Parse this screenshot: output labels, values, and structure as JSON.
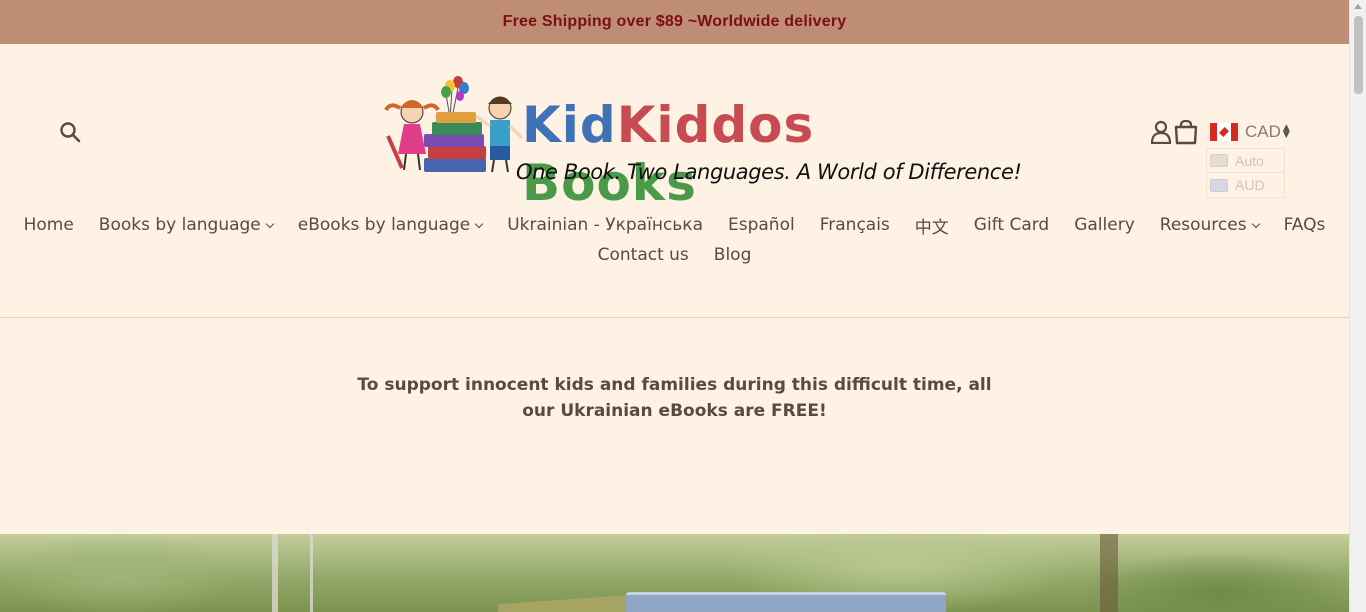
{
  "announcement": {
    "text": "Free Shipping over $89 ~Worldwide delivery"
  },
  "header": {
    "logo": {
      "word_kid": "Kid",
      "word_kiddos": "Kiddos",
      "word_books": "Books",
      "tagline": "One Book. Two Languages. A World of Difference!"
    },
    "search_icon": "search-icon",
    "account_icon": "user-icon",
    "cart_icon": "shopping-bag-icon",
    "currency": {
      "selected": "CAD",
      "options": [
        {
          "label": "Auto"
        },
        {
          "label": "AUD"
        }
      ]
    }
  },
  "nav": {
    "row1": [
      {
        "label": "Home",
        "dropdown": false
      },
      {
        "label": "Books by language",
        "dropdown": true
      },
      {
        "label": "eBooks by language",
        "dropdown": true
      },
      {
        "label": "Ukrainian - Українська",
        "dropdown": false
      },
      {
        "label": "Español",
        "dropdown": false
      },
      {
        "label": "Français",
        "dropdown": false
      },
      {
        "label": "中文",
        "dropdown": false
      },
      {
        "label": "Gift Card",
        "dropdown": false
      },
      {
        "label": "Gallery",
        "dropdown": false
      },
      {
        "label": "Resources",
        "dropdown": true
      },
      {
        "label": "FAQs",
        "dropdown": false
      }
    ],
    "row2": [
      {
        "label": "Contact us",
        "dropdown": false
      },
      {
        "label": "Blog",
        "dropdown": false
      }
    ]
  },
  "notice": {
    "text": "To support innocent kids and families during this difficult time, all our Ukrainian eBooks are FREE!"
  },
  "colors": {
    "announcement_bg": "#bf8d75",
    "announcement_text": "#7a1010",
    "page_bg": "#fdf2e4",
    "text": "#5a4a42"
  }
}
